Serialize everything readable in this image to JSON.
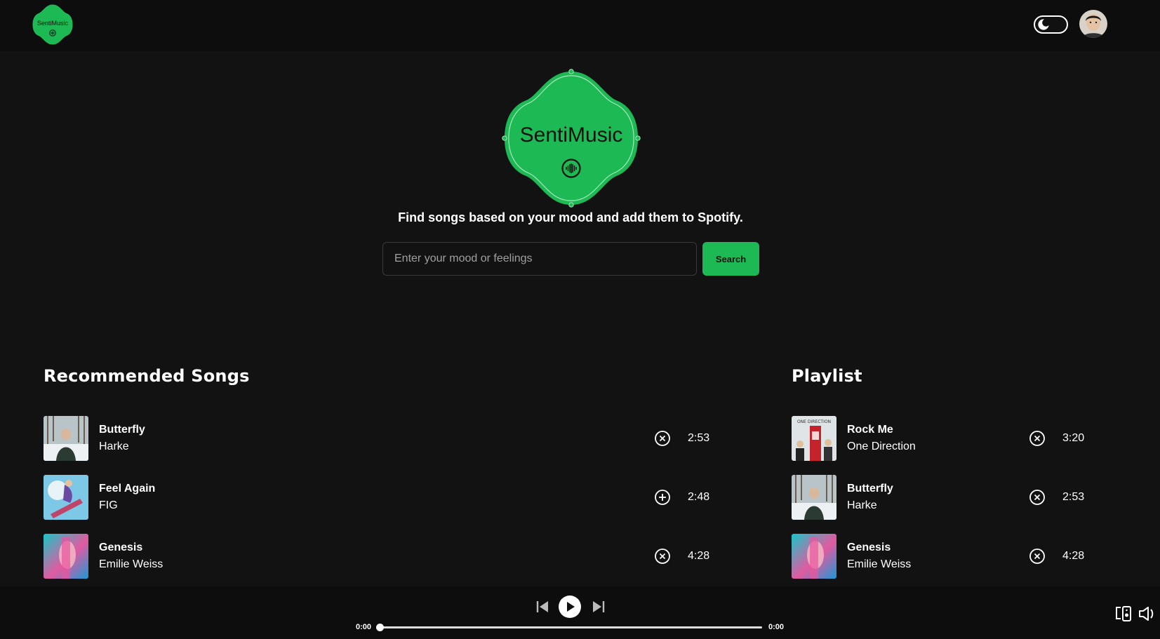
{
  "app": {
    "logo_text": "SentiMusic"
  },
  "header": {
    "theme_toggle": "dark-mode-toggle"
  },
  "hero": {
    "logo_text": "SentiMusic",
    "tagline": "Find songs based on your mood and add them to Spotify.",
    "search_placeholder": "Enter your mood or feelings",
    "search_value": "",
    "search_button": "Search"
  },
  "recommended": {
    "title": "Recommended Songs",
    "songs": [
      {
        "title": "Butterfly",
        "artist": "Harke",
        "duration": "2:53",
        "action": "remove"
      },
      {
        "title": "Feel Again",
        "artist": "FIG",
        "duration": "2:48",
        "action": "add"
      },
      {
        "title": "Genesis",
        "artist": "Emilie Weiss",
        "duration": "4:28",
        "action": "remove"
      }
    ]
  },
  "playlist": {
    "title": "Playlist",
    "songs": [
      {
        "title": "Rock Me",
        "artist": "One Direction",
        "duration": "3:20",
        "action": "remove"
      },
      {
        "title": "Butterfly",
        "artist": "Harke",
        "duration": "2:53",
        "action": "remove"
      },
      {
        "title": "Genesis",
        "artist": "Emilie Weiss",
        "duration": "4:28",
        "action": "remove"
      }
    ]
  },
  "player": {
    "current_time": "0:00",
    "total_time": "0:00",
    "progress": 0
  },
  "colors": {
    "accent": "#1db954",
    "background": "#121212",
    "bar": "#0d0d0d"
  }
}
